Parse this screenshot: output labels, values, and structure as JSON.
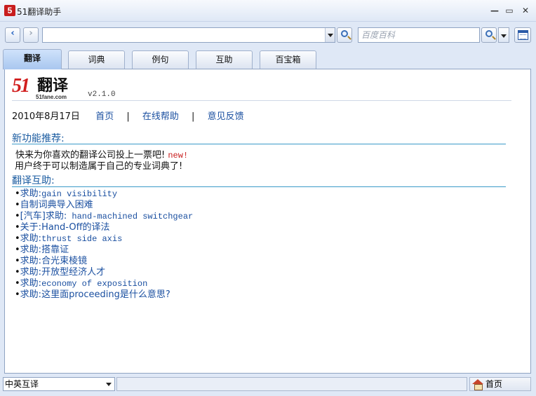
{
  "window": {
    "icon_text": "5",
    "title": "51翻译助手",
    "minimize": "—",
    "maximize": "▭",
    "close": "✕"
  },
  "toolbar": {
    "back": "‹",
    "forward": "›",
    "url_value": "",
    "baike_placeholder": "百度百科"
  },
  "tabs": [
    {
      "label": "翻译",
      "active": true
    },
    {
      "label": "词典",
      "active": false
    },
    {
      "label": "例句",
      "active": false
    },
    {
      "label": "互助",
      "active": false
    },
    {
      "label": "百宝箱",
      "active": false
    }
  ],
  "main": {
    "logo": {
      "number": "51",
      "text": "翻译",
      "subtitle": "51fane.com"
    },
    "version": "v2.1.0",
    "date": "2010年8月17日",
    "links": [
      "首页",
      "在线帮助",
      "意见反馈"
    ],
    "link_sep": "|",
    "new_features": {
      "title": "新功能推荐:",
      "items": [
        {
          "text": "快来为你喜欢的翻译公司投上一票吧!",
          "tag": "new!"
        },
        {
          "text": "用户终于可以制造属于自己的专业词典了!",
          "tag": ""
        }
      ]
    },
    "help": {
      "title": "翻译互助:",
      "bullet": "•",
      "items": [
        {
          "prefix": "求助:",
          "text": "gain visibility",
          "mono": true
        },
        {
          "prefix": "",
          "text": "自制词典导入困难",
          "mono": false
        },
        {
          "prefix": "[汽车]求助:",
          "text": " hand-machined switchgear",
          "mono": true
        },
        {
          "prefix": "关于:",
          "text": "Hand-Off的译法",
          "mono": false
        },
        {
          "prefix": "求助:",
          "text": "thrust side axis",
          "mono": true
        },
        {
          "prefix": "求助:",
          "text": "搭靠证",
          "mono": false
        },
        {
          "prefix": "求助:",
          "text": "合光束棱镜",
          "mono": false
        },
        {
          "prefix": "求助:",
          "text": "开放型经济人才",
          "mono": false
        },
        {
          "prefix": "求助:",
          "text": "economy of exposition",
          "mono": true
        },
        {
          "prefix": "求助:",
          "text": "这里面proceeding是什么意思?",
          "mono": false
        }
      ]
    }
  },
  "status": {
    "language": "中英互译",
    "home": "首页"
  },
  "colors": {
    "accent": "#1a5ba0",
    "rule": "#3a9ac9",
    "new_tag": "#c81d1d",
    "tab_active": "#a9c7ef"
  }
}
